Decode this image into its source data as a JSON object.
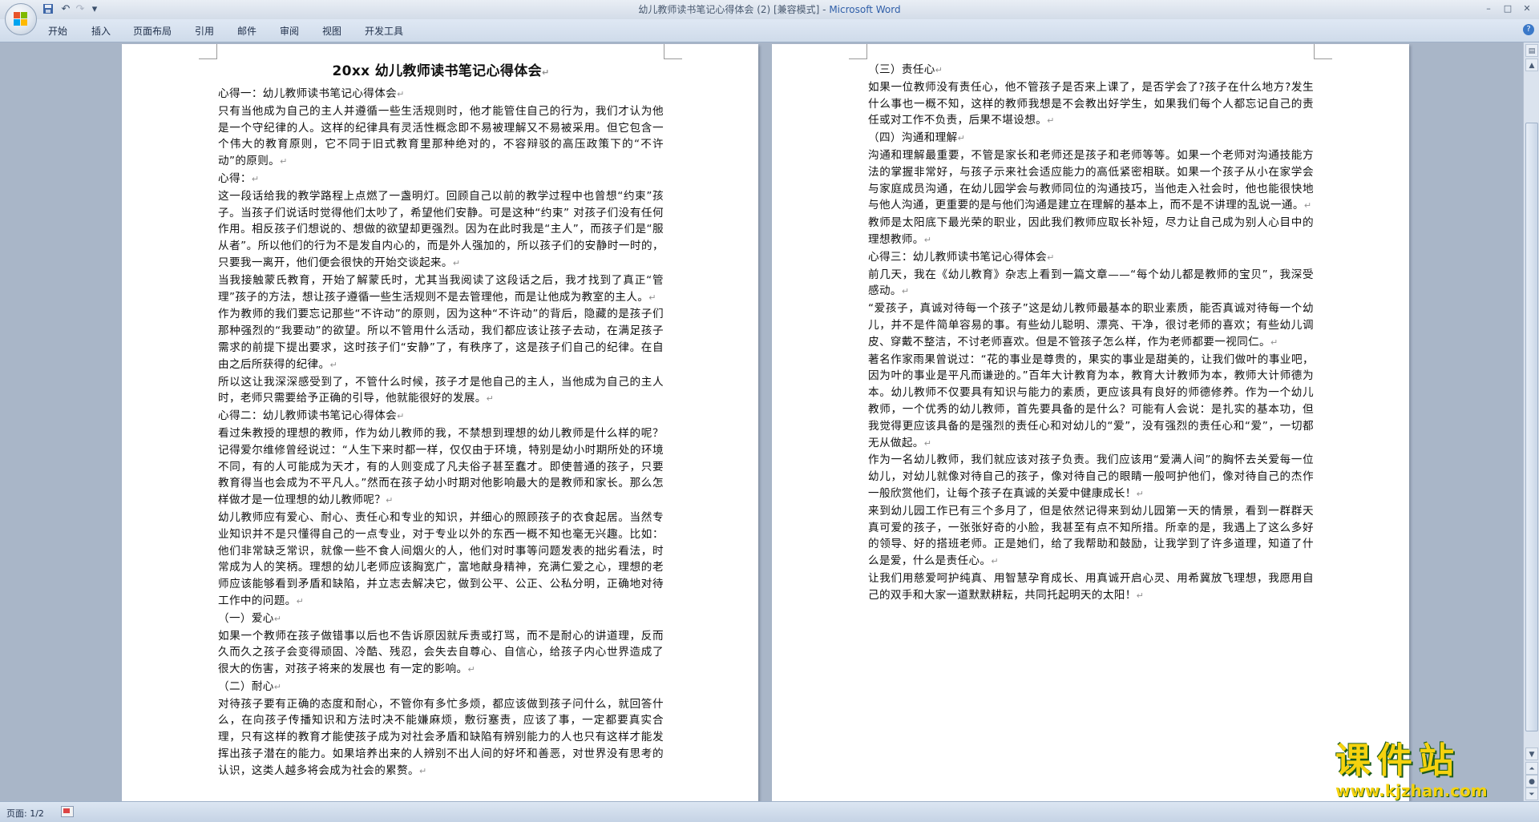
{
  "window": {
    "title_doc": "幼儿教师读书笔记心得体会 (2) [兼容模式] - ",
    "title_app": "Microsoft Word",
    "controls": [
      "–",
      "□",
      "✕"
    ]
  },
  "qat": {
    "save_icon": "save-icon",
    "undo_icon": "undo-icon",
    "redo_icon": "redo-icon",
    "customize": "▾"
  },
  "ribbon": {
    "tabs": [
      "开始",
      "插入",
      "页面布局",
      "引用",
      "邮件",
      "审阅",
      "视图",
      "开发工具"
    ]
  },
  "page1": {
    "title": "20xx 幼儿教师读书笔记心得体会",
    "paragraphs": [
      "心得一：幼儿教师读书笔记心得体会",
      "只有当他成为自己的主人并遵循一些生活规则时，他才能管住自己的行为，我们才认为他是一个守纪律的人。这样的纪律具有灵活性概念即不易被理解又不易被采用。但它包含一个伟大的教育原则，它不同于旧式教育里那种绝对的，不容辩驳的高压政策下的“不许动”的原则。",
      "心得：",
      "这一段话给我的教学路程上点燃了一盏明灯。回顾自己以前的教学过程中也曾想“约束”孩子。当孩子们说话时觉得他们太吵了，希望他们安静。可是这种“约束” 对孩子们没有任何作用。相反孩子们想说的、想做的欲望却更强烈。因为在此时我是“主人”，而孩子们是“服从者”。所以他们的行为不是发自内心的，而是外人强加的，所以孩子们的安静时一时的，只要我一离开，他们便会很快的开始交谈起来。",
      "当我接触蒙氏教育，开始了解蒙氏时，尤其当我阅读了这段话之后，我才找到了真正“管理”孩子的方法，想让孩子遵循一些生活规则不是去管理他，而是让他成为教室的主人。",
      "作为教师的我们要忘记那些“不许动”的原则，因为这种“不许动”的背后，隐藏的是孩子们那种强烈的“我要动”的欲望。所以不管用什么活动，我们都应该让孩子去动，在满足孩子需求的前提下提出要求，这时孩子们“安静”了，有秩序了，这是孩子们自己的纪律。在自由之后所获得的纪律。",
      "所以这让我深深感受到了，不管什么时候，孩子才是他自己的主人，当他成为自己的主人时，老师只需要给予正确的引导，他就能很好的发展。",
      "心得二：幼儿教师读书笔记心得体会",
      "看过朱教授的理想的教师，作为幼儿教师的我，不禁想到理想的幼儿教师是什么样的呢？记得爱尔维修曾经说过：“人生下来时都一样，仅仅由于环境，特别是幼小时期所处的环境不同，有的人可能成为天才，有的人则变成了凡夫俗子甚至蠢才。即使普通的孩子，只要教育得当也会成为不平凡人。”然而在孩子幼小时期对他影响最大的是教师和家长。那么怎样做才是一位理想的幼儿教师呢？",
      "幼儿教师应有爱心、耐心、责任心和专业的知识，并细心的照顾孩子的衣食起居。当然专业知识并不是只懂得自己的一点专业，对于专业以外的东西一概不知也毫无兴趣。比如：他们非常缺乏常识，就像一些不食人间烟火的人，他们对时事等问题发表的拙劣看法，时常成为人的笑柄。理想的幼儿老师应该胸宽广，富地献身精神，充满仁爱之心，理想的老师应该能够看到矛盾和缺陷，并立志去解决它，做到公平、公正、公私分明，正确地对待工作中的问题。",
      "（一）爱心",
      "如果一个教师在孩子做错事以后也不告诉原因就斥责或打骂，而不是耐心的讲道理，反而久而久之孩子会变得顽固、冷酷、残忍，会失去自尊心、自信心，给孩子内心世界造成了很大的伤害，对孩子将来的发展也 有一定的影响。",
      "（二）耐心",
      "对待孩子要有正确的态度和耐心，不管你有多忙多烦，都应该做到孩子问什么，就回答什么，在向孩子传播知识和方法时决不能嫌麻烦，敷衍塞责，应该了事，一定都要真实合理，只有这样的教育才能使孩子成为对社会矛盾和缺陷有辨别能力的人也只有这样才能发挥出孩子潜在的能力。如果培养出来的人辨别不出人间的好坏和善恶，对世界没有思考的认识，这类人越多将会成为社会的累赘。"
    ]
  },
  "page2": {
    "paragraphs": [
      "（三）责任心",
      "如果一位教师没有责任心，他不管孩子是否来上课了，是否学会了?孩子在什么地方?发生什么事也一概不知，这样的教师我想是不会教出好学生，如果我们每个人都忘记自己的责任或对工作不负责，后果不堪设想。",
      "（四）沟通和理解",
      "沟通和理解最重要，不管是家长和老师还是孩子和老师等等。如果一个老师对沟通技能方法的掌握非常好，与孩子示来社会适应能力的高低紧密相联。如果一个孩子从小在家学会与家庭成员沟通，在幼儿园学会与教师同位的沟通技巧，当他走入社会时，他也能很快地与他人沟通，更重要的是与他们沟通是建立在理解的基本上，而不是不讲理的乱说一通。",
      "教师是太阳底下最光荣的职业，因此我们教师应取长补短，尽力让自己成为别人心目中的理想教师。",
      "心得三：幼儿教师读书笔记心得体会",
      "前几天，我在《幼儿教育》杂志上看到一篇文章——“每个幼儿都是教师的宝贝”，我深受感动。",
      "“爱孩子，真诚对待每一个孩子”这是幼儿教师最基本的职业素质，能否真诚对待每一个幼儿，并不是件简单容易的事。有些幼儿聪明、漂亮、干净，很讨老师的喜欢；有些幼儿调皮、穿戴不整洁，不讨老师喜欢。但是不管孩子怎么样，作为老师都要一视同仁。",
      "著名作家雨果曾说过：“花的事业是尊贵的，果实的事业是甜美的，让我们做叶的事业吧，因为叶的事业是平凡而谦逊的。”百年大计教育为本，教育大计教师为本，教师大计师德为本。幼儿教师不仅要具有知识与能力的素质，更应该具有良好的师德修养。作为一个幼儿教师，一个优秀的幼儿教师，首先要具备的是什么？可能有人会说：是扎实的基本功，但我觉得更应该具备的是强烈的责任心和对幼儿的“爱”，没有强烈的责任心和“爱”，一切都无从做起。",
      "作为一名幼儿教师，我们就应该对孩子负责。我们应该用“爱满人间”的胸怀去关爱每一位幼儿，对幼儿就像对待自己的孩子，像对待自己的眼睛一般呵护他们，像对待自己的杰作一般欣赏他们，让每个孩子在真诚的关爱中健康成长！",
      "来到幼儿园工作已有三个多月了，但是依然记得来到幼儿园第一天的情景，看到一群群天真可爱的孩子，一张张好奇的小脸，我甚至有点不知所措。所幸的是，我遇上了这么多好的领导、好的搭班老师。正是她们，给了我帮助和鼓励，让我学到了许多道理，知道了什么是爱，什么是责任心。",
      "让我们用慈爱呵护纯真、用智慧孕育成长、用真诚开启心灵、用希冀放飞理想，我愿用自己的双手和大家一道默默耕耘，共同托起明天的太阳！"
    ]
  },
  "paragraph_mark": "↵",
  "statusbar": {
    "page": "页面: 1/2",
    "proof_icon": "proofing-icon"
  },
  "watermark": {
    "main": "课件站",
    "url": "www.kjzhan.com"
  },
  "colors": {
    "app_title": "#2f5ea8",
    "background": "#a9b6c8",
    "watermark": "#f5d20e"
  }
}
